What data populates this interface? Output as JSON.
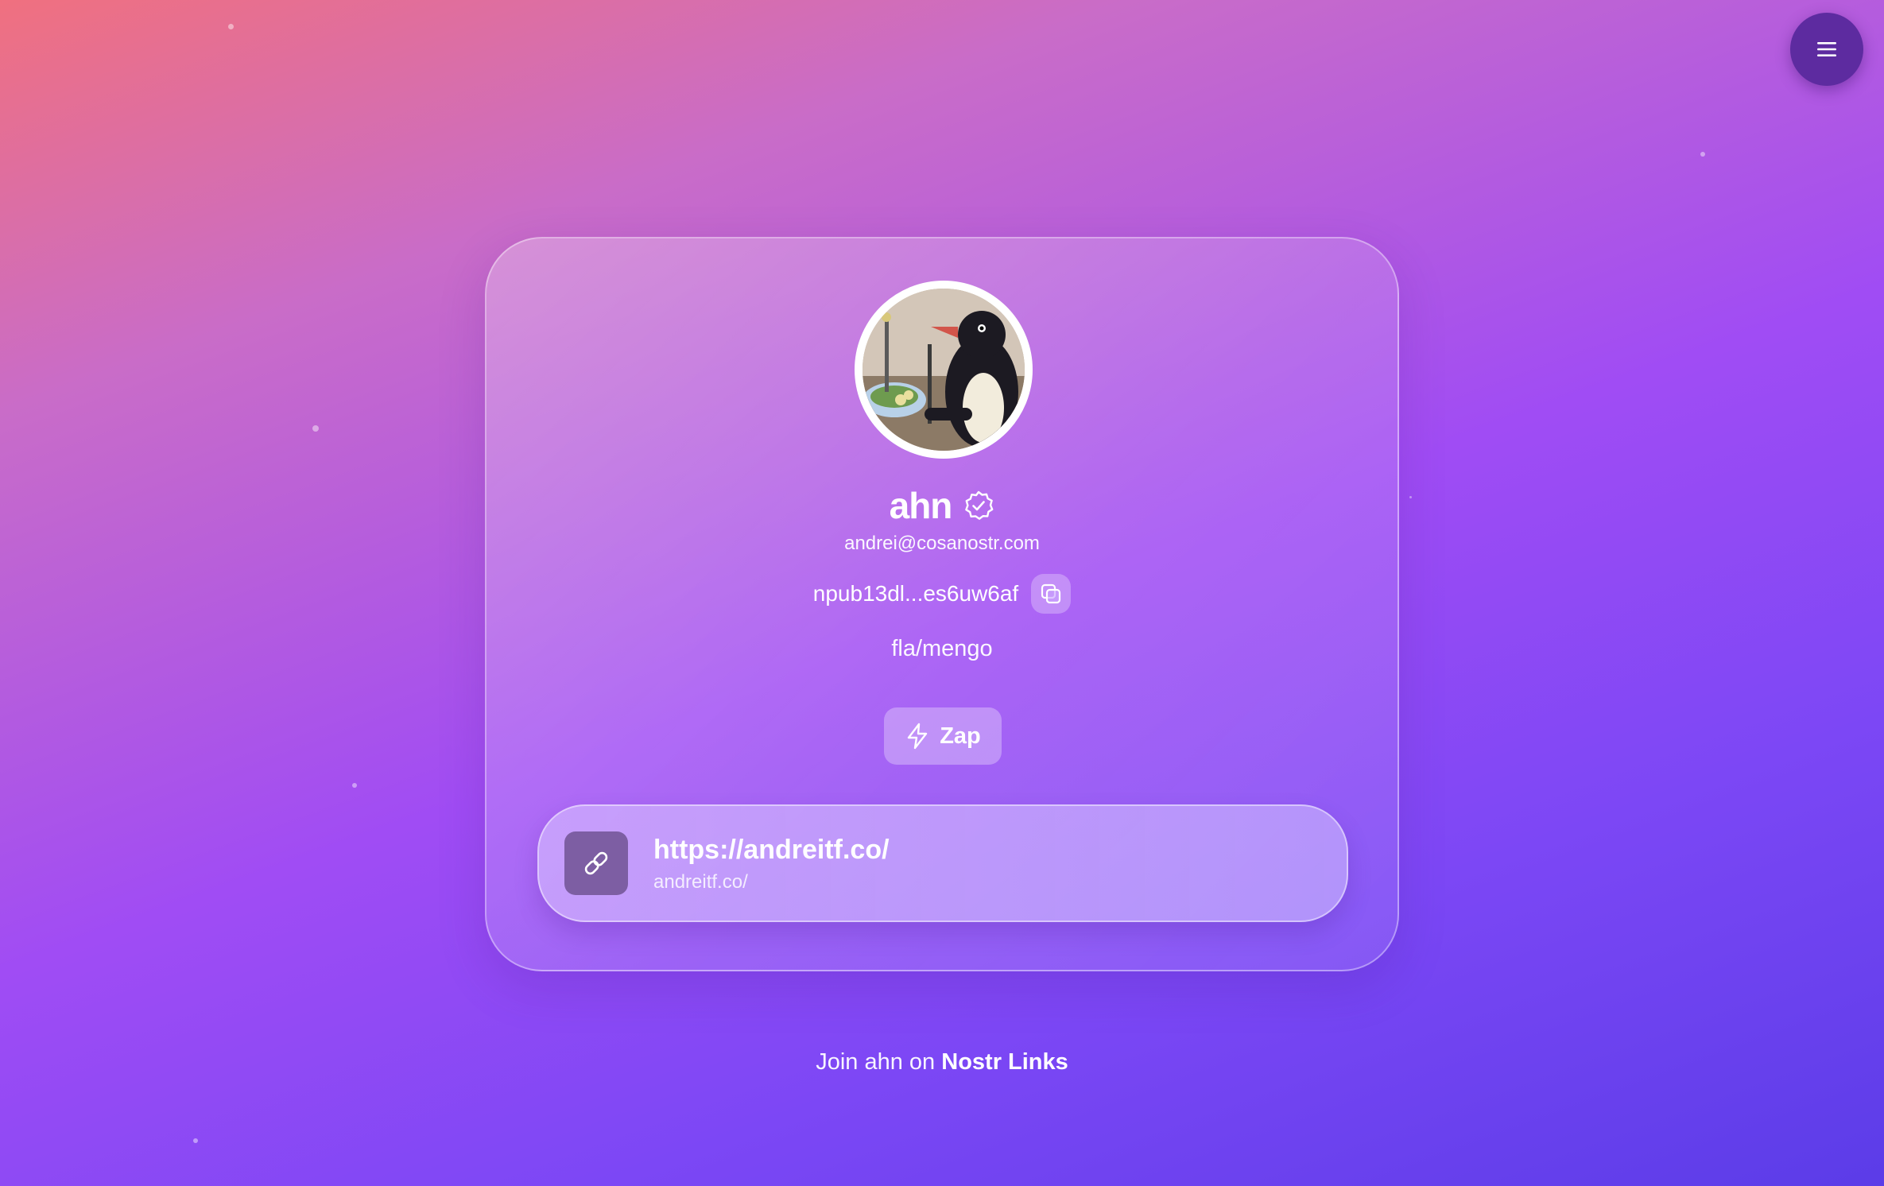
{
  "profile": {
    "name": "ahn",
    "nip05": "andrei@cosanostr.com",
    "npub": "npub13dl...es6uw6af",
    "bio": "fla/mengo"
  },
  "actions": {
    "zap_label": "Zap"
  },
  "links": [
    {
      "title": "https://andreitf.co/",
      "subtitle": "andreitf.co/"
    }
  ],
  "footer": {
    "prefix": "Join ahn on",
    "brand": "Nostr Links"
  },
  "icons": {
    "menu": "hamburger-icon",
    "verified": "verified-badge-icon",
    "copy": "copy-icon",
    "zap": "lightning-bolt-icon",
    "link": "chain-link-icon"
  }
}
